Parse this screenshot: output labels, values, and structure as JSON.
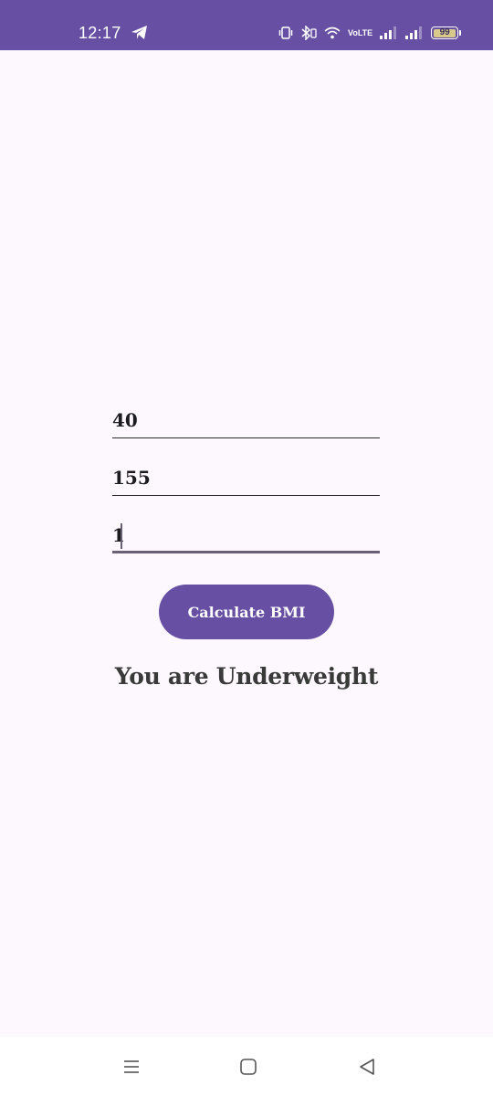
{
  "status_bar": {
    "time": "12:17",
    "volte_label": "VoLTE",
    "battery_level": "99",
    "icons": [
      "telegram-icon",
      "vibrate-icon",
      "bluetooth-icon",
      "wifi-icon",
      "volte-icon",
      "signal-icon",
      "signal-icon",
      "battery-icon"
    ],
    "background_color": "#6750a4"
  },
  "form": {
    "weight_value": "40",
    "height_value": "155",
    "age_value": "1",
    "accent_color": "#6750a4"
  },
  "calculate_button": {
    "label": "Calculate BMI"
  },
  "result": {
    "text": "You are Underweight"
  },
  "nav_bar": {
    "icons": [
      "recents-icon",
      "home-icon",
      "back-icon"
    ]
  }
}
